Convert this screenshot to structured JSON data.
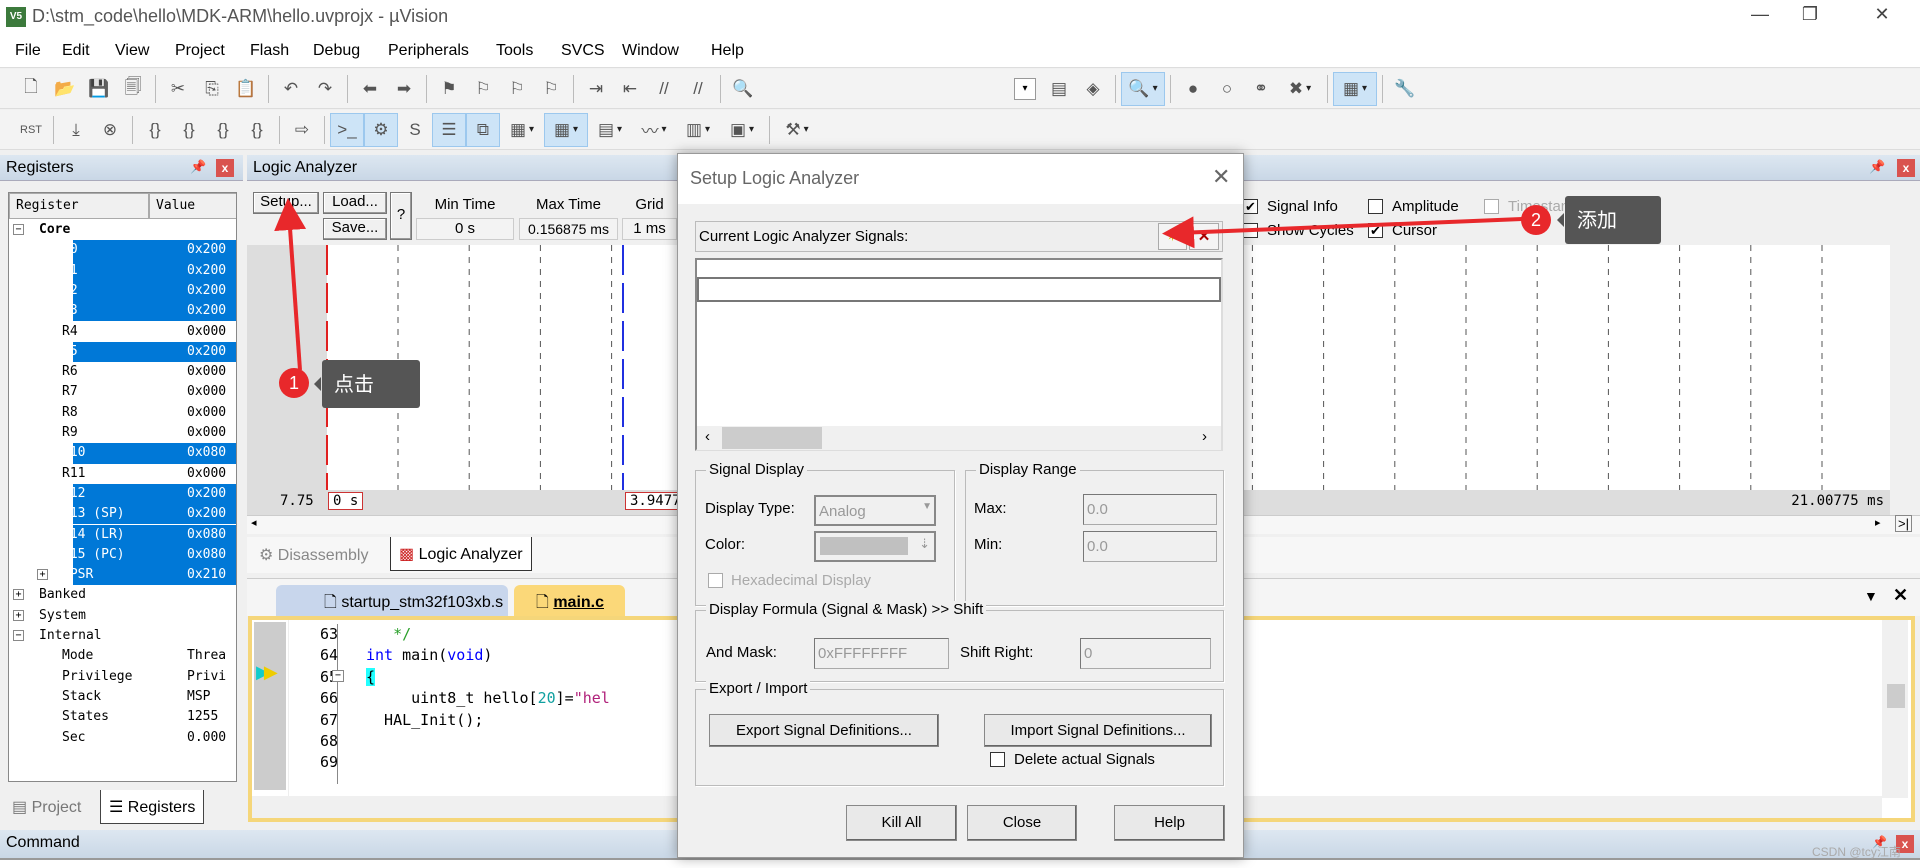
{
  "window": {
    "title": "D:\\stm_code\\hello\\MDK-ARM\\hello.uvprojx - µVision",
    "app_icon": "V5",
    "minimize": "—",
    "maximize": "❐",
    "close": "✕"
  },
  "menu": [
    "File",
    "Edit",
    "View",
    "Project",
    "Flash",
    "Debug",
    "Peripherals",
    "Tools",
    "SVCS",
    "Window",
    "Help"
  ],
  "toolbar1": [
    {
      "icon": "new-file-icon",
      "g": "🗋"
    },
    {
      "icon": "open-folder-icon",
      "g": "📂"
    },
    {
      "icon": "save-icon",
      "g": "💾"
    },
    {
      "icon": "save-all-icon",
      "g": "🗐"
    },
    {
      "sep": true
    },
    {
      "icon": "cut-icon",
      "g": "✂"
    },
    {
      "icon": "copy-icon",
      "g": "⎘"
    },
    {
      "icon": "paste-icon",
      "g": "📋"
    },
    {
      "sep": true
    },
    {
      "icon": "undo-icon",
      "g": "↶"
    },
    {
      "icon": "redo-icon",
      "g": "↷"
    },
    {
      "sep": true
    },
    {
      "icon": "navigate-back-icon",
      "g": "⬅"
    },
    {
      "icon": "navigate-forward-icon",
      "g": "➡"
    },
    {
      "sep": true
    },
    {
      "icon": "bookmark-icon",
      "g": "⚑"
    },
    {
      "icon": "prev-bookmark-icon",
      "g": "⚐"
    },
    {
      "icon": "next-bookmark-icon",
      "g": "⚐"
    },
    {
      "icon": "clear-bookmarks-icon",
      "g": "⚐"
    },
    {
      "sep": true
    },
    {
      "icon": "indent-icon",
      "g": "⇥"
    },
    {
      "icon": "unindent-icon",
      "g": "⇤"
    },
    {
      "icon": "comment-icon",
      "g": "//"
    },
    {
      "icon": "uncomment-icon",
      "g": "//"
    },
    {
      "sep": true
    },
    {
      "icon": "find-in-files-icon",
      "g": "🔍"
    }
  ],
  "toolbar1_right": [
    {
      "icon": "target-combo-icon",
      "g": "▾",
      "combo": true
    },
    {
      "icon": "file-extensions-icon",
      "g": "▤"
    },
    {
      "icon": "manage-components-icon",
      "g": "◈"
    },
    {
      "sep": true
    },
    {
      "icon": "start-debug-icon",
      "g": "🔍",
      "hl": true,
      "dd": true
    },
    {
      "sep": true
    },
    {
      "icon": "insert-breakpoint-icon",
      "g": "●"
    },
    {
      "icon": "enable-breakpoint-icon",
      "g": "○"
    },
    {
      "icon": "disable-all-breakpoints-icon",
      "g": "⚭"
    },
    {
      "icon": "kill-all-breakpoints-icon",
      "g": "✖",
      "dd": true
    },
    {
      "sep": true
    },
    {
      "icon": "window-layout-icon",
      "g": "▦",
      "hl": true,
      "dd": true
    },
    {
      "sep": true
    },
    {
      "icon": "configure-icon",
      "g": "🔧"
    }
  ],
  "toolbar2": [
    {
      "icon": "reset-cpu-icon",
      "g": "RST"
    },
    {
      "sep": true
    },
    {
      "icon": "run-icon",
      "g": "⤓"
    },
    {
      "icon": "stop-icon",
      "g": "⊗"
    },
    {
      "sep": true
    },
    {
      "icon": "step-into-icon",
      "g": "{}"
    },
    {
      "icon": "step-over-icon",
      "g": "{}"
    },
    {
      "icon": "step-out-icon",
      "g": "{}"
    },
    {
      "icon": "run-to-cursor-icon",
      "g": "{}"
    },
    {
      "sep": true
    },
    {
      "icon": "show-next-statement-icon",
      "g": "⇨"
    },
    {
      "sep": true
    },
    {
      "icon": "command-window-icon",
      "g": ">_",
      "hl": true
    },
    {
      "icon": "disassembly-window-icon",
      "g": "⚙",
      "hl": true
    },
    {
      "icon": "symbols-window-icon",
      "g": "S"
    },
    {
      "icon": "registers-window-icon",
      "g": "☰",
      "hl": true
    },
    {
      "icon": "call-stack-window-icon",
      "g": "⧉",
      "hl": true
    },
    {
      "icon": "watch-window-icon",
      "g": "▦",
      "dd": true
    },
    {
      "icon": "memory-window-icon",
      "g": "▦",
      "hl": true,
      "dd": true
    },
    {
      "icon": "serial-window-icon",
      "g": "▤",
      "dd": true
    },
    {
      "icon": "analysis-window-icon",
      "g": "〰",
      "dd": true
    },
    {
      "icon": "trace-window-icon",
      "g": "▥",
      "dd": true
    },
    {
      "icon": "system-viewer-icon",
      "g": "▣",
      "dd": true
    },
    {
      "sep": true
    },
    {
      "icon": "toolbox-icon",
      "g": "⚒",
      "dd": true
    }
  ],
  "registers": {
    "title": "Registers",
    "col_register": "Register",
    "col_value": "Value",
    "rows": [
      {
        "name": "Core",
        "value": "",
        "level": 0,
        "expander": "−",
        "bold": true
      },
      {
        "name": "R0",
        "value": "0x200",
        "level": 1,
        "sel": true
      },
      {
        "name": "R1",
        "value": "0x200",
        "level": 1,
        "sel": true
      },
      {
        "name": "R2",
        "value": "0x200",
        "level": 1,
        "sel": true
      },
      {
        "name": "R3",
        "value": "0x200",
        "level": 1,
        "sel": true
      },
      {
        "name": "R4",
        "value": "0x000",
        "level": 1
      },
      {
        "name": "R5",
        "value": "0x200",
        "level": 1,
        "sel": true
      },
      {
        "name": "R6",
        "value": "0x000",
        "level": 1
      },
      {
        "name": "R7",
        "value": "0x000",
        "level": 1
      },
      {
        "name": "R8",
        "value": "0x000",
        "level": 1
      },
      {
        "name": "R9",
        "value": "0x000",
        "level": 1
      },
      {
        "name": "R10",
        "value": "0x080",
        "level": 1,
        "sel": true
      },
      {
        "name": "R11",
        "value": "0x000",
        "level": 1
      },
      {
        "name": "R12",
        "value": "0x200",
        "level": 1,
        "sel": true
      },
      {
        "name": "R13 (SP)",
        "value": "0x200",
        "level": 1,
        "sel": true
      },
      {
        "name": "R14 (LR)",
        "value": "0x080",
        "level": 1,
        "sel": true
      },
      {
        "name": "R15 (PC)",
        "value": "0x080",
        "level": 1,
        "sel": true
      },
      {
        "name": "xPSR",
        "value": "0x210",
        "level": 1,
        "sel": true,
        "expander": "+"
      },
      {
        "name": "Banked",
        "value": "",
        "level": 0,
        "expander": "+"
      },
      {
        "name": "System",
        "value": "",
        "level": 0,
        "expander": "+"
      },
      {
        "name": "Internal",
        "value": "",
        "level": 0,
        "expander": "−"
      },
      {
        "name": "Mode",
        "value": "Threa",
        "level": 1
      },
      {
        "name": "Privilege",
        "value": "Privi",
        "level": 1
      },
      {
        "name": "Stack",
        "value": "MSP",
        "level": 1
      },
      {
        "name": "States",
        "value": "1255",
        "level": 1
      },
      {
        "name": "Sec",
        "value": "0.000",
        "level": 1
      }
    ],
    "tabs": [
      {
        "label": "Project",
        "icon": "project-icon"
      },
      {
        "label": "Registers",
        "icon": "registers-icon",
        "active": true
      }
    ]
  },
  "logic_analyzer": {
    "title": "Logic Analyzer",
    "setup": "Setup...",
    "load": "Load...",
    "save": "Save...",
    "help": "?",
    "min_time_label": "Min Time",
    "min_time": "0 s",
    "max_time_label": "Max Time",
    "max_time": "0.156875 ms",
    "grid_label": "Grid",
    "grid": "1 ms",
    "signal_info": {
      "label": "Signal Info",
      "checked": true
    },
    "amplitude": {
      "label": "Amplitude",
      "checked": false
    },
    "timestamps": {
      "label": "Timestamps Enable",
      "checked": false
    },
    "show_cycles": {
      "label": "Show Cycles",
      "checked": false
    },
    "cursor": {
      "label": "Cursor",
      "checked": true
    },
    "time_left": "7.75",
    "cursor_start": "0 s",
    "cursor_pos": "3.9477",
    "time_right": "21.00775 ms",
    "cursor_color": "#e02020",
    "marker_color": "#2030e0"
  },
  "view_tabs": [
    {
      "label": "Disassembly",
      "icon": "disassembly-icon"
    },
    {
      "label": "Logic Analyzer",
      "icon": "logic-analyzer-icon",
      "active": true
    }
  ],
  "editor": {
    "tabs": [
      {
        "label": "startup_stm32f103xb.s"
      },
      {
        "label": "main.c",
        "active": true
      }
    ],
    "lines": [
      {
        "n": "63",
        "seg": [
          [
            "   */",
            "cm"
          ]
        ]
      },
      {
        "n": "64",
        "seg": [
          [
            "int",
            "kw"
          ],
          [
            " main(",
            "tx"
          ],
          [
            "void",
            "kw"
          ],
          [
            ")",
            "tx"
          ]
        ]
      },
      {
        "n": "65",
        "seg": [
          [
            "{",
            "br"
          ]
        ]
      },
      {
        "n": "66",
        "seg": [
          [
            "     uint8_t hello[",
            "tx"
          ],
          [
            "20",
            "num"
          ],
          [
            "]=",
            "tx"
          ],
          [
            "\"hel",
            "str"
          ]
        ]
      },
      {
        "n": "67",
        "seg": [
          [
            "  HAL_Init();",
            "tx"
          ]
        ]
      },
      {
        "n": "68",
        "seg": []
      },
      {
        "n": "69",
        "seg": []
      }
    ]
  },
  "command": {
    "title": "Command"
  },
  "dialog": {
    "title": "Setup Logic Analyzer",
    "signals_label": "Current Logic Analyzer Signals:",
    "signal_display": "Signal Display",
    "display_type_label": "Display Type:",
    "display_type": "Analog",
    "color_label": "Color:",
    "hex_display": "Hexadecimal Display",
    "display_range": "Display Range",
    "max_label": "Max:",
    "max": "0.0",
    "min_label": "Min:",
    "min": "0.0",
    "formula": "Display Formula (Signal & Mask) >> Shift",
    "and_mask_label": "And Mask:",
    "and_mask": "0xFFFFFFFF",
    "shift_right_label": "Shift Right:",
    "shift_right": "0",
    "export_import": "Export / Import",
    "export_btn": "Export Signal Definitions...",
    "import_btn": "Import Signal Definitions...",
    "delete_signals": "Delete actual Signals",
    "kill_all": "Kill All",
    "close": "Close",
    "help": "Help"
  },
  "annotations": [
    {
      "num": "1",
      "text": "点击"
    },
    {
      "num": "2",
      "text": "添加"
    }
  ],
  "watermark": "CSDN @tcy江南"
}
